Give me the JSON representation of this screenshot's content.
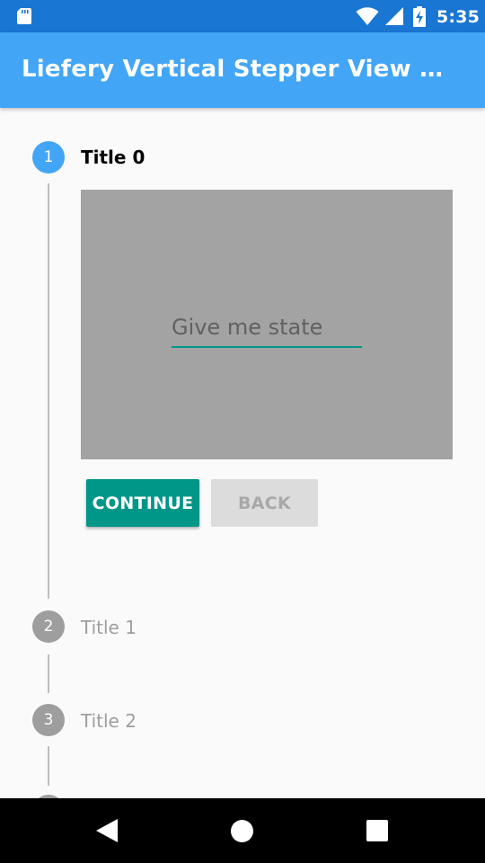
{
  "status_bar": {
    "time": "5:35",
    "icons": [
      "sd-card-icon",
      "wifi-icon",
      "cell-signal-icon",
      "battery-charging-icon"
    ]
  },
  "app_bar": {
    "title": "Liefery Vertical Stepper View Sam…"
  },
  "stepper": {
    "steps": [
      {
        "number": "1",
        "title": "Title 0",
        "state": "active"
      },
      {
        "number": "2",
        "title": "Title 1",
        "state": "inactive"
      },
      {
        "number": "3",
        "title": "Title 2",
        "state": "inactive"
      }
    ],
    "content": {
      "input_placeholder": "Give me state",
      "input_value": ""
    },
    "buttons": {
      "continue_label": "CONTINUE",
      "back_label": "BACK"
    }
  },
  "nav_bar": {
    "icons": [
      "back-icon",
      "home-icon",
      "recents-icon"
    ]
  },
  "colors": {
    "status_bar": "#1976d2",
    "app_bar": "#42a5f5",
    "active_step": "#42a5f5",
    "inactive_step": "#9e9e9e",
    "accent": "#009688",
    "content_card": "#a3a3a3"
  }
}
